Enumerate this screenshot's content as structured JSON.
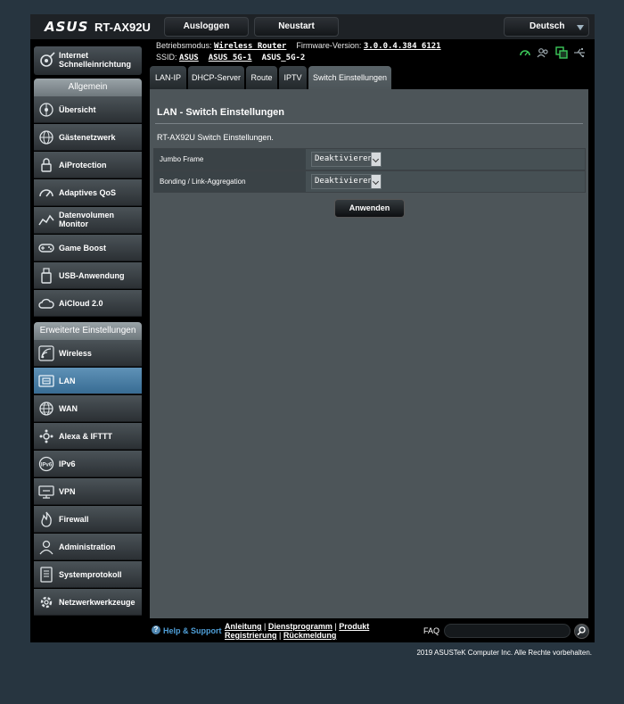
{
  "header": {
    "brand": "ASUS",
    "model": "RT-AX92U",
    "logout_label": "Ausloggen",
    "restart_label": "Neustart",
    "language": "Deutsch"
  },
  "info": {
    "mode_label": "Betriebsmodus:",
    "mode_value": "Wireless Router",
    "firmware_label": "Firmware-Version:",
    "firmware_value": "3.0.0.4.384_6121",
    "ssid_label": "SSID:",
    "ssids": [
      "ASUS",
      "ASUS_5G-1",
      "ASUS_5G-2"
    ]
  },
  "sidebar": {
    "qis_label_line1": "Internet",
    "qis_label_line2": "Schnelleinrichtung",
    "general_header": "Allgemein",
    "general_items": [
      {
        "label": "Übersicht",
        "icon": "network-map-icon"
      },
      {
        "label": "Gästenetzwerk",
        "icon": "globe-icon"
      },
      {
        "label": "AiProtection",
        "icon": "lock-icon"
      },
      {
        "label": "Adaptives QoS",
        "icon": "speedometer-icon"
      },
      {
        "label_line1": "Datenvolumen",
        "label_line2": "Monitor",
        "icon": "traffic-chart-icon"
      },
      {
        "label": "Game Boost",
        "icon": "gamepad-icon"
      },
      {
        "label": "USB-Anwendung",
        "icon": "usb-icon"
      },
      {
        "label": "AiCloud 2.0",
        "icon": "cloud-icon"
      }
    ],
    "advanced_header": "Erweiterte Einstellungen",
    "advanced_items": [
      {
        "label": "Wireless",
        "icon": "wireless-icon"
      },
      {
        "label": "LAN",
        "icon": "lan-icon",
        "active": true
      },
      {
        "label": "WAN",
        "icon": "globe-icon"
      },
      {
        "label": "Alexa & IFTTT",
        "icon": "alexa-icon"
      },
      {
        "label": "IPv6",
        "icon": "ipv6-icon"
      },
      {
        "label": "VPN",
        "icon": "vpn-icon"
      },
      {
        "label": "Firewall",
        "icon": "fire-icon"
      },
      {
        "label": "Administration",
        "icon": "admin-icon"
      },
      {
        "label": "Systemprotokoll",
        "icon": "log-icon"
      },
      {
        "label": "Netzwerkwerkzeuge",
        "icon": "tools-icon"
      }
    ]
  },
  "tabs": [
    {
      "label": "LAN-IP"
    },
    {
      "label": "DHCP-Server"
    },
    {
      "label": "Route"
    },
    {
      "label": "IPTV"
    },
    {
      "label": "Switch Einstellungen",
      "active": true
    }
  ],
  "main": {
    "title": "LAN - Switch Einstellungen",
    "description": "RT-AX92U Switch Einstellungen.",
    "rows": [
      {
        "label": "Jumbo Frame",
        "value": "Deaktivieren"
      },
      {
        "label": "Bonding / Link-Aggregation",
        "value": "Deaktivieren"
      }
    ],
    "apply_label": "Anwenden"
  },
  "footer": {
    "help_label": "Help & Support",
    "links": [
      "Anleitung",
      "Dienstprogramm",
      "Produkt Registrierung",
      "Rückmeldung"
    ],
    "separator": "|",
    "faq_label": "FAQ",
    "copyright": "2019 ASUSTeK Computer Inc. Alle Rechte vorbehalten."
  },
  "colors": {
    "page_bg": "#273540",
    "content_bg": "#4d5559",
    "active_nav": "#4a7fa6",
    "link_blue": "#4f9fd8",
    "status_green": "#3cc85a"
  }
}
